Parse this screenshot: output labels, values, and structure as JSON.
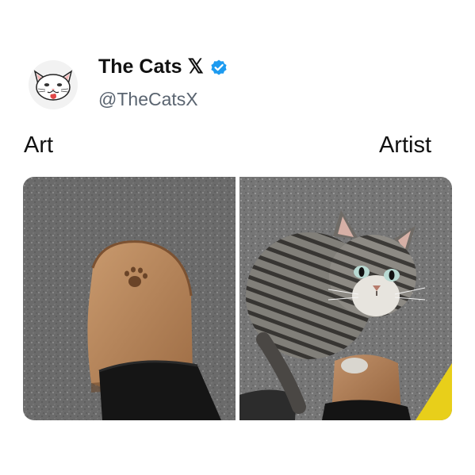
{
  "post": {
    "display_name": "The Cats",
    "x_badge": "𝕏",
    "handle": "@TheCatsX",
    "verified_color": "#1D9BF0",
    "avatar_icon": "cat-avatar-icon"
  },
  "labels": {
    "left": "Art",
    "right": "Artist"
  },
  "images": {
    "left": "shoe-with-paw-print-image",
    "right": "tabby-cat-on-shoe-image"
  }
}
